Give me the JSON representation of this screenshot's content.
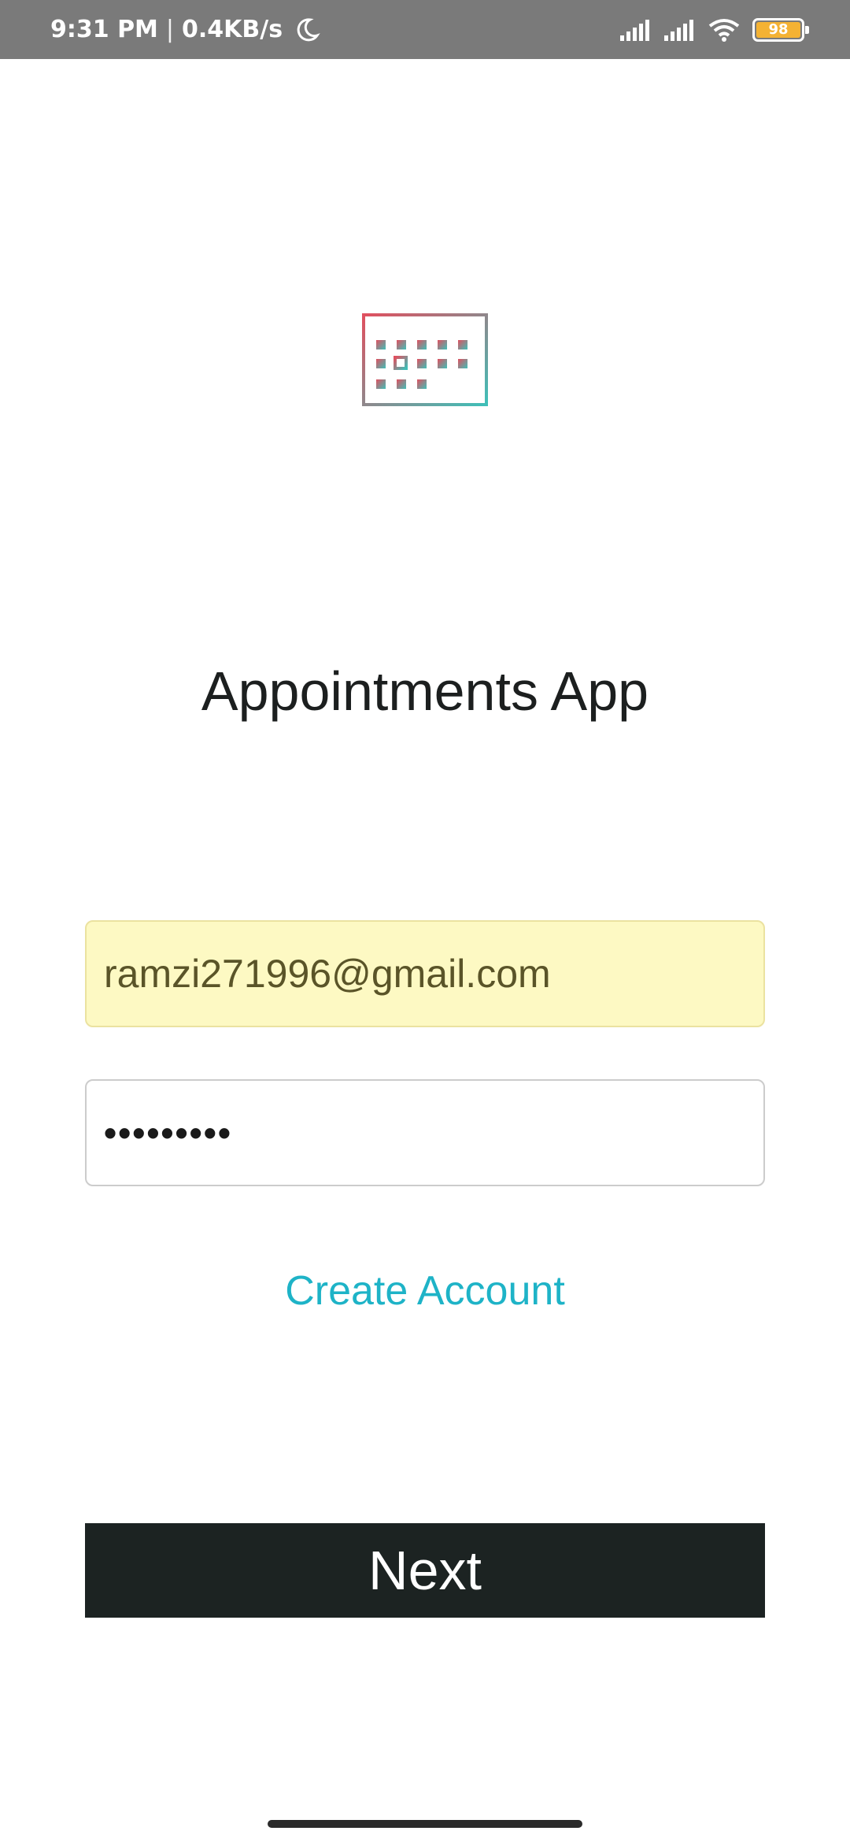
{
  "status_bar": {
    "time": "9:31 PM",
    "separator": "|",
    "network_speed": "0.4KB/s",
    "battery_level": "98",
    "icons": [
      "moon-icon",
      "signal-icon",
      "signal-icon",
      "wifi-icon",
      "battery-icon"
    ]
  },
  "app": {
    "logo_icon": "calendar-icon",
    "title": "Appointments App"
  },
  "form": {
    "email_value": "ramzi271996@gmail.com",
    "password_value": "•••••••••",
    "create_account_label": "Create Account",
    "next_label": "Next"
  },
  "colors": {
    "status_bar": "#7a7a7a",
    "email_autofill_bg": "#fdf9c3",
    "link": "#1eb3c7",
    "button_bg": "#1c2322",
    "logo_gradient_start": "#e0505f",
    "logo_gradient_end": "#3fbfb8",
    "battery": "#f4b233"
  }
}
